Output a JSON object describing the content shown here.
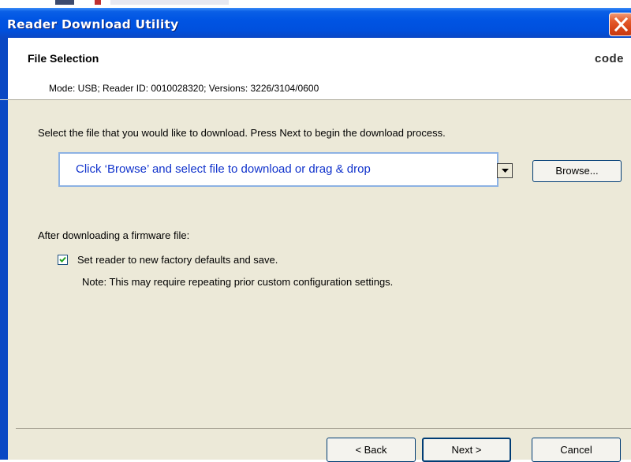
{
  "window": {
    "title": "Reader Download Utility"
  },
  "header": {
    "title": "File Selection",
    "logo_text": "code",
    "mode_line": "Mode: USB; Reader ID: 0010028320; Versions: 3226/3104/0600"
  },
  "main": {
    "instruction": "Select the file that you would like to download. Press Next to begin the download process.",
    "file_callout": "Click ‘Browse’ and select file to download or drag & drop",
    "browse_label": "Browse...",
    "after_label": "After downloading a firmware file:",
    "checkbox": {
      "label": "Set reader to new factory defaults and save.",
      "checked": true
    },
    "note": "Note: This may require repeating prior custom configuration settings."
  },
  "footer": {
    "back_label": "< Back",
    "next_label": "Next >",
    "cancel_label": "Cancel"
  },
  "icons": {
    "close": "close-icon",
    "dropdown": "chevron-down-icon",
    "check": "check-icon"
  },
  "colors": {
    "titlebar_blue": "#0054e3",
    "close_red": "#d64317",
    "dialog_background": "#ece9d8",
    "callout_border": "#8db2e3",
    "callout_text": "#1133cc"
  }
}
